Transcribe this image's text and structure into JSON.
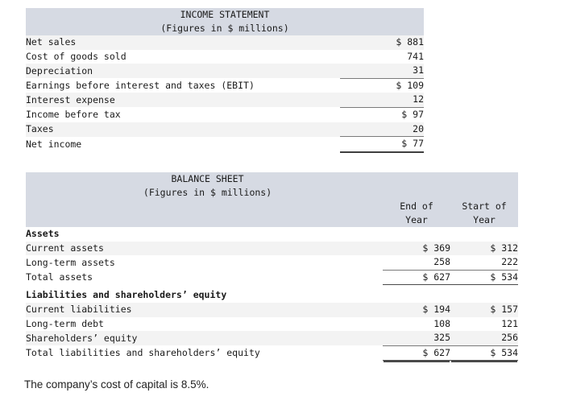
{
  "income_statement": {
    "title": "INCOME STATEMENT",
    "subtitle": "(Figures in $ millions)",
    "rows": [
      {
        "label": "Net sales",
        "value": "$ 881"
      },
      {
        "label": "Cost of goods sold",
        "value": "741"
      },
      {
        "label": "Depreciation",
        "value": "31"
      },
      {
        "label": "Earnings before interest and taxes (EBIT)",
        "value": "$ 109"
      },
      {
        "label": "Interest expense",
        "value": "12"
      },
      {
        "label": "Income before tax",
        "value": "$ 97"
      },
      {
        "label": "Taxes",
        "value": "20"
      },
      {
        "label": "Net income",
        "value": "$ 77"
      }
    ]
  },
  "balance_sheet": {
    "title": "BALANCE SHEET",
    "subtitle": "(Figures in $ millions)",
    "col_end_line1": "End of",
    "col_end_line2": "Year",
    "col_start_line1": "Start of",
    "col_start_line2": "Year",
    "assets_header": "Assets",
    "assets_rows": [
      {
        "label": "Current assets",
        "end": "$ 369",
        "start": "$ 312"
      },
      {
        "label": "Long-term assets",
        "end": "258",
        "start": "222"
      }
    ],
    "assets_total": {
      "label": "Total assets",
      "end": "$ 627",
      "start": "$ 534"
    },
    "liabilities_header": "Liabilities and shareholders’ equity",
    "liabilities_rows": [
      {
        "label": "Current liabilities",
        "end": "$ 194",
        "start": "$ 157"
      },
      {
        "label": "Long-term debt",
        "end": "108",
        "start": "121"
      },
      {
        "label": "Shareholders’ equity",
        "end": "325",
        "start": "256"
      }
    ],
    "liabilities_total": {
      "label": "Total liabilities and shareholders’ equity",
      "end": "$ 627",
      "start": "$ 534"
    }
  },
  "footnote": {
    "text": "The company’s cost of capital is 8.5%."
  }
}
